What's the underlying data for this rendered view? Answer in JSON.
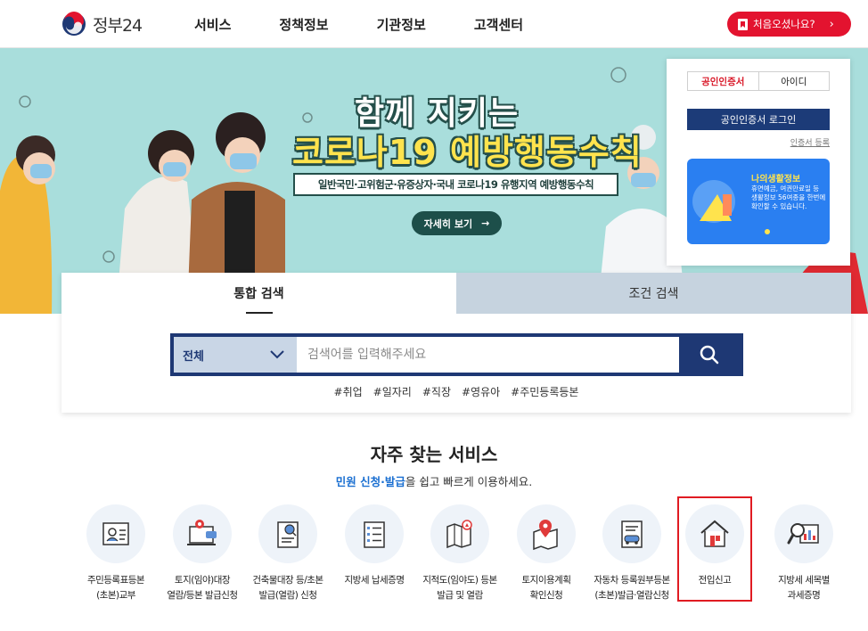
{
  "header": {
    "logo_text": "정부24",
    "nav": [
      "서비스",
      "정책정보",
      "기관정보",
      "고객센터"
    ],
    "first_visit_label": "처음오셨나요?",
    "first_visit_arrow": "›"
  },
  "banner": {
    "title_line1": "함께 지키는",
    "title_line2": "코로나19 예방행동수칙",
    "subtitle": "일반국민·고위험군·유증상자·국내 코로나19 유행지역 예방행동수칙",
    "detail_button": "자세히 보기",
    "detail_arrow": "→"
  },
  "login": {
    "tab_cert": "공인인증서",
    "tab_id": "아이디",
    "login_button": "공인인증서 로그인",
    "cert_register": "인증서 등록",
    "life_info_title": "나의생활정보",
    "life_info_desc": "휴면예금, 여권만료일 등 생활정보 56여종을 한번에 확인할 수 있습니다."
  },
  "search": {
    "tab_integrated": "통합 검색",
    "tab_condition": "조건 검색",
    "select_value": "전체",
    "placeholder": "검색어를 입력해주세요",
    "hashtags": [
      "#취업",
      "#일자리",
      "#직장",
      "#영유아",
      "#주민등록등본"
    ]
  },
  "frequent": {
    "title": "자주 찾는 서비스",
    "subtitle_highlight": "민원 신청·발급",
    "subtitle_rest": "을 쉽고 빠르게 이용하세요.",
    "services": [
      {
        "line1": "주민등록표등본",
        "line2": "(초본)교부",
        "icon": "id-card-icon"
      },
      {
        "line1": "토지(임야)대장",
        "line2": "열람/등본 발급신청",
        "icon": "map-laptop-icon"
      },
      {
        "line1": "건축물대장 등/초본",
        "line2": "발급(열람) 신청",
        "icon": "document-search-icon"
      },
      {
        "line1": "지방세 납세증명",
        "line2": "",
        "icon": "checklist-icon"
      },
      {
        "line1": "지적도(임야도) 등본",
        "line2": "발급 및 열람",
        "icon": "map-compass-icon"
      },
      {
        "line1": "토지이용계획",
        "line2": "확인신청",
        "icon": "map-pin-icon"
      },
      {
        "line1": "자동차 등록원부등본",
        "line2": "(초본)발급·열람신청",
        "icon": "car-document-icon"
      },
      {
        "line1": "전입신고",
        "line2": "",
        "icon": "house-icon"
      },
      {
        "line1": "지방세 세목별",
        "line2": "과세증명",
        "icon": "magnifier-chart-icon"
      }
    ]
  },
  "colors": {
    "brand_red": "#e3132f",
    "navy": "#1e3874",
    "banner_bg": "#a9dedc",
    "highlight_outline": "#e01b22"
  }
}
